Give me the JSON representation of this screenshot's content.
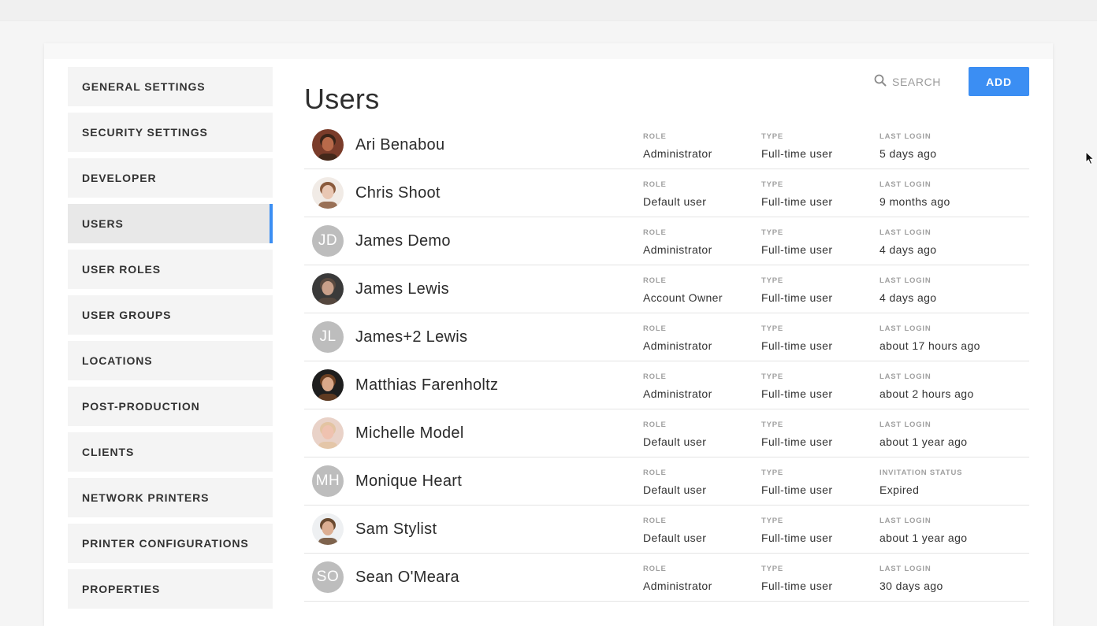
{
  "sidebar": {
    "items": [
      {
        "label": "GENERAL SETTINGS",
        "active": false
      },
      {
        "label": "SECURITY SETTINGS",
        "active": false
      },
      {
        "label": "DEVELOPER",
        "active": false
      },
      {
        "label": "USERS",
        "active": true
      },
      {
        "label": "USER ROLES",
        "active": false
      },
      {
        "label": "USER GROUPS",
        "active": false
      },
      {
        "label": "LOCATIONS",
        "active": false
      },
      {
        "label": "POST-PRODUCTION",
        "active": false
      },
      {
        "label": "CLIENTS",
        "active": false
      },
      {
        "label": "NETWORK PRINTERS",
        "active": false
      },
      {
        "label": "PRINTER CONFIGURATIONS",
        "active": false
      },
      {
        "label": "PROPERTIES",
        "active": false
      }
    ]
  },
  "header": {
    "title": "Users",
    "search_label": "SEARCH",
    "add_label": "ADD"
  },
  "users": [
    {
      "name": "Ari Benabou",
      "avatar": {
        "kind": "photo",
        "skin": "#b86a4a",
        "hair": "#3a2418",
        "bg": "#7a3c2a"
      },
      "role_label": "ROLE",
      "role": "Administrator",
      "type_label": "TYPE",
      "type": "Full-time user",
      "login_label": "LAST LOGIN",
      "login": "5 days ago"
    },
    {
      "name": "Chris Shoot",
      "avatar": {
        "kind": "photo",
        "skin": "#e9c7b3",
        "hair": "#8a5a3c",
        "bg": "#f1ebe6"
      },
      "role_label": "ROLE",
      "role": "Default user",
      "type_label": "TYPE",
      "type": "Full-time user",
      "login_label": "LAST LOGIN",
      "login": "9 months ago"
    },
    {
      "name": "James Demo",
      "avatar": {
        "kind": "initials",
        "initials": "JD"
      },
      "role_label": "ROLE",
      "role": "Administrator",
      "type_label": "TYPE",
      "type": "Full-time user",
      "login_label": "LAST LOGIN",
      "login": "4 days ago"
    },
    {
      "name": "James Lewis",
      "avatar": {
        "kind": "photo",
        "skin": "#c9a08a",
        "hair": "#5a4a40",
        "bg": "#3a3a3a"
      },
      "role_label": "ROLE",
      "role": "Account Owner",
      "type_label": "TYPE",
      "type": "Full-time user",
      "login_label": "LAST LOGIN",
      "login": "4 days ago"
    },
    {
      "name": "James+2 Lewis",
      "avatar": {
        "kind": "initials",
        "initials": "JL"
      },
      "role_label": "ROLE",
      "role": "Administrator",
      "type_label": "TYPE",
      "type": "Full-time user",
      "login_label": "LAST LOGIN",
      "login": "about 17 hours ago"
    },
    {
      "name": "Matthias Farenholtz",
      "avatar": {
        "kind": "photo",
        "skin": "#d9a88a",
        "hair": "#6b3f22",
        "bg": "#1e1e1e"
      },
      "role_label": "ROLE",
      "role": "Administrator",
      "type_label": "TYPE",
      "type": "Full-time user",
      "login_label": "LAST LOGIN",
      "login": "about 2 hours ago"
    },
    {
      "name": "Michelle Model",
      "avatar": {
        "kind": "photo",
        "skin": "#efc2b0",
        "hair": "#e3c4a2",
        "bg": "#e9d2c8"
      },
      "role_label": "ROLE",
      "role": "Default user",
      "type_label": "TYPE",
      "type": "Full-time user",
      "login_label": "LAST LOGIN",
      "login": "about 1 year ago"
    },
    {
      "name": "Monique Heart",
      "avatar": {
        "kind": "initials",
        "initials": "MH"
      },
      "role_label": "ROLE",
      "role": "Default user",
      "type_label": "TYPE",
      "type": "Full-time user",
      "login_label": "INVITATION STATUS",
      "login": "Expired"
    },
    {
      "name": "Sam Stylist",
      "avatar": {
        "kind": "photo",
        "skin": "#dcae92",
        "hair": "#6a4a30",
        "bg": "#eef0f2"
      },
      "role_label": "ROLE",
      "role": "Default user",
      "type_label": "TYPE",
      "type": "Full-time user",
      "login_label": "LAST LOGIN",
      "login": "about 1 year ago"
    },
    {
      "name": "Sean O'Meara",
      "avatar": {
        "kind": "initials",
        "initials": "SO"
      },
      "role_label": "ROLE",
      "role": "Administrator",
      "type_label": "TYPE",
      "type": "Full-time user",
      "login_label": "LAST LOGIN",
      "login": "30 days ago"
    }
  ],
  "colors": {
    "accent": "#3b8ef3",
    "initials_bg": "#bdbdbd"
  },
  "icons": {
    "search": "search-icon",
    "cursor": "mouse-pointer-icon"
  }
}
